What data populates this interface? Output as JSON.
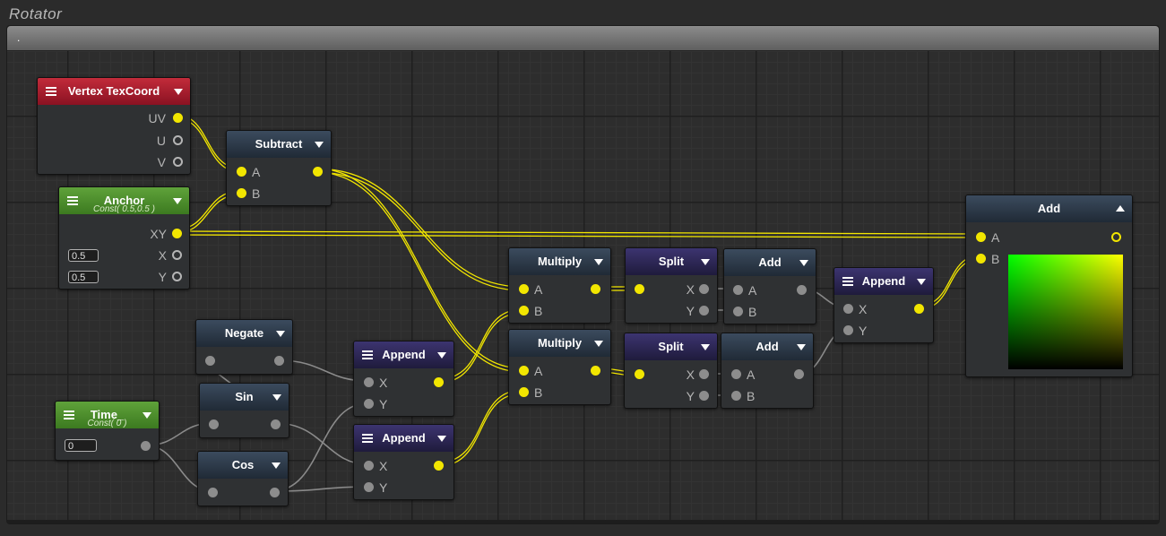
{
  "window": {
    "title": "Rotator",
    "header_text": "."
  },
  "colors": {
    "wire": "#f2e600",
    "wire_inactive": "#8a8a8a",
    "port_active": "#f2e600",
    "port_inactive": "#8d8d8d"
  },
  "nodes": {
    "vertex_texcoord": {
      "title": "Vertex TexCoord",
      "ports": [
        "UV",
        "U",
        "V"
      ]
    },
    "anchor": {
      "title": "Anchor",
      "subtitle": "Const( 0.5,0.5 )",
      "ports": [
        "XY",
        "X",
        "Y"
      ],
      "x_value": "0.5",
      "y_value": "0.5"
    },
    "time": {
      "title": "Time_",
      "subtitle": "Const( 0 )",
      "value": "0"
    },
    "subtract": {
      "title": "Subtract",
      "ports": [
        "A",
        "B"
      ]
    },
    "negate": {
      "title": "Negate"
    },
    "sin": {
      "title": "Sin"
    },
    "cos": {
      "title": "Cos"
    },
    "append_1": {
      "title": "Append",
      "ports": [
        "X",
        "Y"
      ]
    },
    "append_2": {
      "title": "Append",
      "ports": [
        "X",
        "Y"
      ]
    },
    "multiply_1": {
      "title": "Multiply",
      "ports": [
        "A",
        "B"
      ]
    },
    "multiply_2": {
      "title": "Multiply",
      "ports": [
        "A",
        "B"
      ]
    },
    "split_1": {
      "title": "Split",
      "ports": [
        "X",
        "Y"
      ]
    },
    "split_2": {
      "title": "Split",
      "ports": [
        "X",
        "Y"
      ]
    },
    "add_1": {
      "title": "Add",
      "ports": [
        "A",
        "B"
      ]
    },
    "add_2": {
      "title": "Add",
      "ports": [
        "A",
        "B"
      ]
    },
    "append_3": {
      "title": "Append",
      "ports": [
        "X",
        "Y"
      ]
    },
    "add_out": {
      "title": "Add",
      "ports": [
        "A",
        "B"
      ]
    }
  }
}
